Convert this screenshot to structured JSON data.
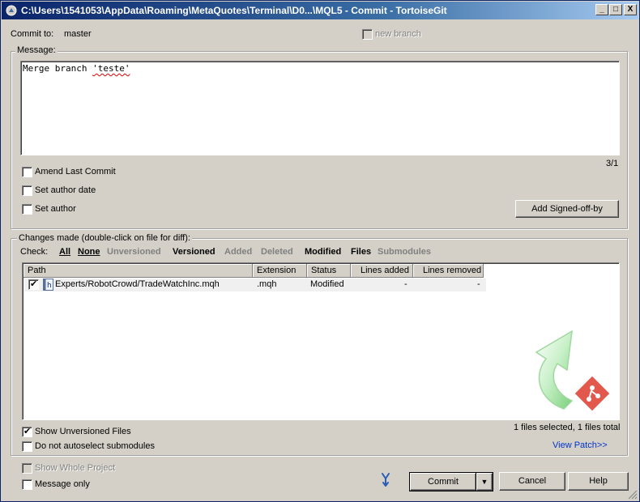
{
  "window": {
    "title": "C:\\Users\\1541053\\AppData\\Roaming\\MetaQuotes\\Terminal\\D0...\\MQL5 - Commit - TortoiseGit",
    "minimize_glyph": "_",
    "maximize_glyph": "□",
    "close_glyph": "X"
  },
  "commit": {
    "commit_to_label": "Commit to:",
    "branch": "master",
    "new_branch_label": "new branch"
  },
  "message": {
    "group_label": "Message:",
    "text_prefix": "Merge branch ",
    "text_flagged": "'teste'",
    "position": "3/1"
  },
  "options": {
    "amend_last_commit": "Amend Last Commit",
    "set_author_date": "Set author date",
    "set_author": "Set author",
    "add_signed_off_by": "Add Signed-off-by"
  },
  "changes": {
    "group_label": "Changes made (double-click on file for diff):",
    "check_label": "Check:",
    "filters": {
      "all": "All",
      "none": "None",
      "unversioned": "Unversioned",
      "versioned": "Versioned",
      "added": "Added",
      "deleted": "Deleted",
      "modified": "Modified",
      "files": "Files",
      "submodules": "Submodules"
    },
    "columns": [
      "Path",
      "Extension",
      "Status",
      "Lines added",
      "Lines removed"
    ],
    "rows": [
      {
        "checked": true,
        "path": "Experts/RobotCrowd/TradeWatchInc.mqh",
        "extension": ".mqh",
        "status": "Modified",
        "lines_added": "-",
        "lines_removed": "-"
      }
    ],
    "file_icon_letter": "h",
    "selection_summary": "1 files selected, 1 files total",
    "view_patch": "View Patch>>"
  },
  "bottom": {
    "show_unversioned_files": "Show Unversioned Files",
    "do_not_autoselect_submodules": "Do not autoselect submodules",
    "show_whole_project": "Show Whole Project",
    "message_only": "Message only",
    "commit_button": "Commit",
    "commit_dropdown_glyph": "▼",
    "cancel_button": "Cancel",
    "help_button": "Help"
  },
  "colors": {
    "titlebar_start": "#0a246a",
    "titlebar_end": "#a6caf0",
    "dialog_bg": "#d4d0c8",
    "link": "#0033cc",
    "git_logo": "#e0463a"
  }
}
